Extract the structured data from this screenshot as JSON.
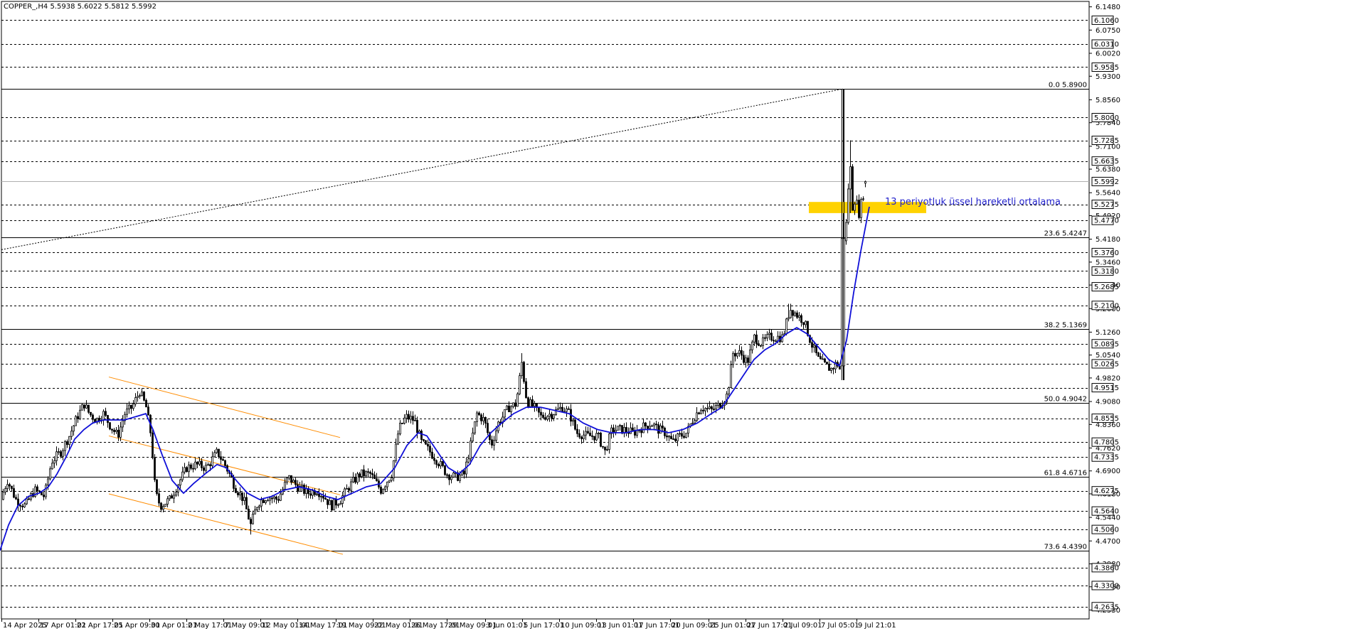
{
  "header": {
    "symbol": "COPPER_,H4",
    "ohlc": "5.5938 5.6022 5.5812 5.5992"
  },
  "colors": {
    "grid": "#000000",
    "candle": "#000000",
    "ema": "#1010d8",
    "channel": "#ff8c00",
    "zone": "#ffd200",
    "annotation": "#2222cc"
  },
  "chart_data": {
    "type": "candlestick",
    "symbol": "COPPER_",
    "timeframe": "H4",
    "last": {
      "open": 5.5938,
      "high": 5.6022,
      "low": 5.5812,
      "close": 5.5992
    },
    "ylim": [
      4.225,
      6.165
    ],
    "ticks": [
      6.148,
      6.075,
      6.002,
      5.93,
      5.856,
      5.784,
      5.71,
      5.638,
      5.564,
      5.492,
      5.418,
      5.346,
      5.274,
      5.2,
      5.126,
      5.054,
      4.982,
      4.908,
      4.836,
      4.762,
      4.69,
      4.618,
      4.544,
      4.47,
      4.398,
      4.326,
      4.253
    ],
    "tick_labels": [
      "6.1480",
      "6.0750",
      "6.0020",
      "5.9300",
      "5.8560",
      "5.7840",
      "5.7100",
      "5.6380",
      "5.5640",
      "5.4920",
      "5.4180",
      "5.3460",
      "5.2740",
      "5.2000",
      "5.1260",
      "5.0540",
      "4.9820",
      "4.9080",
      "4.8360",
      "4.7620",
      "4.6900",
      "4.6180",
      "4.5440",
      "4.4700",
      "4.3980",
      "4.3260",
      "4.2530"
    ],
    "levels": [
      6.106,
      6.031,
      5.9585,
      5.8,
      5.7285,
      5.6635,
      5.5275,
      5.477,
      5.376,
      5.318,
      5.2685,
      5.21,
      5.0895,
      5.0265,
      4.9515,
      4.8555,
      4.7805,
      4.7335,
      4.6275,
      4.564,
      4.506,
      4.386,
      4.33,
      4.2635
    ],
    "level_labels": [
      "6.1060",
      "6.0310",
      "5.9585",
      "5.8000",
      "5.7285",
      "5.6635",
      "5.5275",
      "5.4770",
      "5.3760",
      "5.3180",
      "5.2685",
      "5.2100",
      "5.0895",
      "5.0265",
      "4.9515",
      "4.8555",
      "4.7805",
      "4.7335",
      "4.6275",
      "4.5640",
      "4.5060",
      "4.3860",
      "4.3300",
      "4.2635"
    ],
    "current_price": 5.5992,
    "current_price_label": "5.5992",
    "fib": [
      {
        "pct": "0.0",
        "value": 5.89,
        "label": "0.0 5.8900"
      },
      {
        "pct": "23.6",
        "value": 5.4247,
        "label": "23.6 5.4247"
      },
      {
        "pct": "38.2",
        "value": 5.1369,
        "label": "38.2 5.1369"
      },
      {
        "pct": "50.0",
        "value": 4.9042,
        "label": "50.0 4.9042"
      },
      {
        "pct": "61.8",
        "value": 4.6716,
        "label": "61.8 4.6716"
      },
      {
        "pct": "73.6",
        "value": 4.439,
        "label": "73.6 4.4390"
      }
    ],
    "time_labels": [
      "14 Apr 2025",
      "17 Apr 01:01",
      "22 Apr 17:01",
      "25 Apr 09:01",
      "30 Apr 01:01",
      "2 May 17:01",
      "7 May 09:01",
      "12 May 01:01",
      "14 May 17:01",
      "19 May 09:01",
      "22 May 01:01",
      "26 May 17:01",
      "29 May 09:01",
      "3 Jun 01:01",
      "5 Jun 17:01",
      "10 Jun 09:01",
      "13 Jun 01:01",
      "17 Jun 17:01",
      "20 Jun 09:01",
      "25 Jun 01:01",
      "27 Jun 17:01",
      "2 Jul 09:01",
      "7 Jul 05:01",
      "9 Jul 21:01"
    ],
    "path": [
      [
        0,
        4.6
      ],
      [
        10,
        4.66
      ],
      [
        22,
        4.6
      ],
      [
        35,
        4.58
      ],
      [
        48,
        4.63
      ],
      [
        62,
        4.61
      ],
      [
        72,
        4.72
      ],
      [
        85,
        4.75
      ],
      [
        97,
        4.8
      ],
      [
        108,
        4.86
      ],
      [
        118,
        4.9
      ],
      [
        125,
        4.87
      ],
      [
        135,
        4.85
      ],
      [
        145,
        4.87
      ],
      [
        155,
        4.83
      ],
      [
        165,
        4.8
      ],
      [
        175,
        4.87
      ],
      [
        185,
        4.89
      ],
      [
        196,
        4.94
      ],
      [
        205,
        4.89
      ],
      [
        212,
        4.8
      ],
      [
        218,
        4.62
      ],
      [
        225,
        4.58
      ],
      [
        238,
        4.6
      ],
      [
        250,
        4.65
      ],
      [
        262,
        4.7
      ],
      [
        275,
        4.71
      ],
      [
        290,
        4.7
      ],
      [
        305,
        4.75
      ],
      [
        318,
        4.7
      ],
      [
        330,
        4.64
      ],
      [
        342,
        4.6
      ],
      [
        352,
        4.52
      ],
      [
        362,
        4.59
      ],
      [
        375,
        4.61
      ],
      [
        390,
        4.6
      ],
      [
        405,
        4.67
      ],
      [
        418,
        4.64
      ],
      [
        432,
        4.62
      ],
      [
        445,
        4.63
      ],
      [
        455,
        4.61
      ],
      [
        465,
        4.58
      ],
      [
        478,
        4.6
      ],
      [
        490,
        4.64
      ],
      [
        505,
        4.68
      ],
      [
        520,
        4.68
      ],
      [
        535,
        4.63
      ],
      [
        550,
        4.68
      ],
      [
        560,
        4.82
      ],
      [
        570,
        4.86
      ],
      [
        582,
        4.85
      ],
      [
        592,
        4.78
      ],
      [
        604,
        4.75
      ],
      [
        615,
        4.72
      ],
      [
        628,
        4.68
      ],
      [
        640,
        4.67
      ],
      [
        652,
        4.68
      ],
      [
        660,
        4.76
      ],
      [
        670,
        4.87
      ],
      [
        680,
        4.85
      ],
      [
        690,
        4.77
      ],
      [
        700,
        4.84
      ],
      [
        715,
        4.89
      ],
      [
        725,
        4.9
      ],
      [
        733,
        5.03
      ],
      [
        740,
        4.91
      ],
      [
        750,
        4.89
      ],
      [
        760,
        4.86
      ],
      [
        775,
        4.87
      ],
      [
        790,
        4.89
      ],
      [
        800,
        4.87
      ],
      [
        810,
        4.81
      ],
      [
        825,
        4.8
      ],
      [
        840,
        4.8
      ],
      [
        850,
        4.75
      ],
      [
        860,
        4.82
      ],
      [
        875,
        4.82
      ],
      [
        890,
        4.81
      ],
      [
        905,
        4.83
      ],
      [
        915,
        4.84
      ],
      [
        925,
        4.82
      ],
      [
        935,
        4.81
      ],
      [
        945,
        4.78
      ],
      [
        955,
        4.8
      ],
      [
        965,
        4.81
      ],
      [
        975,
        4.86
      ],
      [
        985,
        4.89
      ],
      [
        1000,
        4.88
      ],
      [
        1012,
        4.9
      ],
      [
        1022,
        4.93
      ],
      [
        1030,
        5.06
      ],
      [
        1040,
        5.06
      ],
      [
        1050,
        5.03
      ],
      [
        1060,
        5.11
      ],
      [
        1070,
        5.09
      ],
      [
        1080,
        5.11
      ],
      [
        1092,
        5.11
      ],
      [
        1100,
        5.11
      ],
      [
        1110,
        5.2
      ],
      [
        1120,
        5.18
      ],
      [
        1130,
        5.16
      ],
      [
        1140,
        5.09
      ],
      [
        1150,
        5.04
      ],
      [
        1160,
        5.02
      ],
      [
        1168,
        5.01
      ],
      [
        1176,
        5.03
      ],
      [
        1182,
        5.0
      ],
      [
        1186,
        5.42
      ],
      [
        1190,
        5.48
      ],
      [
        1194,
        5.68
      ],
      [
        1198,
        5.52
      ],
      [
        1202,
        5.55
      ],
      [
        1207,
        5.5
      ],
      [
        1212,
        5.55
      ],
      [
        1217,
        5.6
      ]
    ],
    "ema": [
      [
        0,
        4.44
      ],
      [
        12,
        4.52
      ],
      [
        25,
        4.58
      ],
      [
        40,
        4.61
      ],
      [
        55,
        4.62
      ],
      [
        68,
        4.64
      ],
      [
        80,
        4.68
      ],
      [
        92,
        4.73
      ],
      [
        105,
        4.79
      ],
      [
        118,
        4.82
      ],
      [
        130,
        4.84
      ],
      [
        145,
        4.85
      ],
      [
        160,
        4.85
      ],
      [
        175,
        4.85
      ],
      [
        190,
        4.86
      ],
      [
        205,
        4.87
      ],
      [
        215,
        4.82
      ],
      [
        228,
        4.74
      ],
      [
        242,
        4.66
      ],
      [
        258,
        4.62
      ],
      [
        272,
        4.65
      ],
      [
        288,
        4.68
      ],
      [
        305,
        4.71
      ],
      [
        318,
        4.7
      ],
      [
        332,
        4.66
      ],
      [
        348,
        4.62
      ],
      [
        365,
        4.6
      ],
      [
        382,
        4.61
      ],
      [
        400,
        4.63
      ],
      [
        420,
        4.64
      ],
      [
        440,
        4.63
      ],
      [
        458,
        4.61
      ],
      [
        475,
        4.6
      ],
      [
        495,
        4.62
      ],
      [
        515,
        4.64
      ],
      [
        535,
        4.65
      ],
      [
        555,
        4.7
      ],
      [
        572,
        4.77
      ],
      [
        588,
        4.81
      ],
      [
        600,
        4.8
      ],
      [
        615,
        4.75
      ],
      [
        630,
        4.7
      ],
      [
        645,
        4.68
      ],
      [
        660,
        4.71
      ],
      [
        675,
        4.77
      ],
      [
        690,
        4.81
      ],
      [
        705,
        4.84
      ],
      [
        722,
        4.87
      ],
      [
        740,
        4.89
      ],
      [
        760,
        4.89
      ],
      [
        780,
        4.88
      ],
      [
        800,
        4.87
      ],
      [
        820,
        4.84
      ],
      [
        840,
        4.82
      ],
      [
        860,
        4.81
      ],
      [
        880,
        4.81
      ],
      [
        900,
        4.82
      ],
      [
        920,
        4.82
      ],
      [
        940,
        4.81
      ],
      [
        960,
        4.82
      ],
      [
        980,
        4.84
      ],
      [
        1000,
        4.87
      ],
      [
        1015,
        4.89
      ],
      [
        1030,
        4.94
      ],
      [
        1045,
        4.99
      ],
      [
        1060,
        5.04
      ],
      [
        1075,
        5.07
      ],
      [
        1090,
        5.09
      ],
      [
        1105,
        5.12
      ],
      [
        1120,
        5.14
      ],
      [
        1135,
        5.12
      ],
      [
        1150,
        5.08
      ],
      [
        1165,
        5.04
      ],
      [
        1180,
        5.02
      ],
      [
        1190,
        5.1
      ],
      [
        1200,
        5.25
      ],
      [
        1210,
        5.38
      ],
      [
        1222,
        5.52
      ]
    ],
    "annotation": "13 periyotluk üssel hareketli ortalama"
  }
}
